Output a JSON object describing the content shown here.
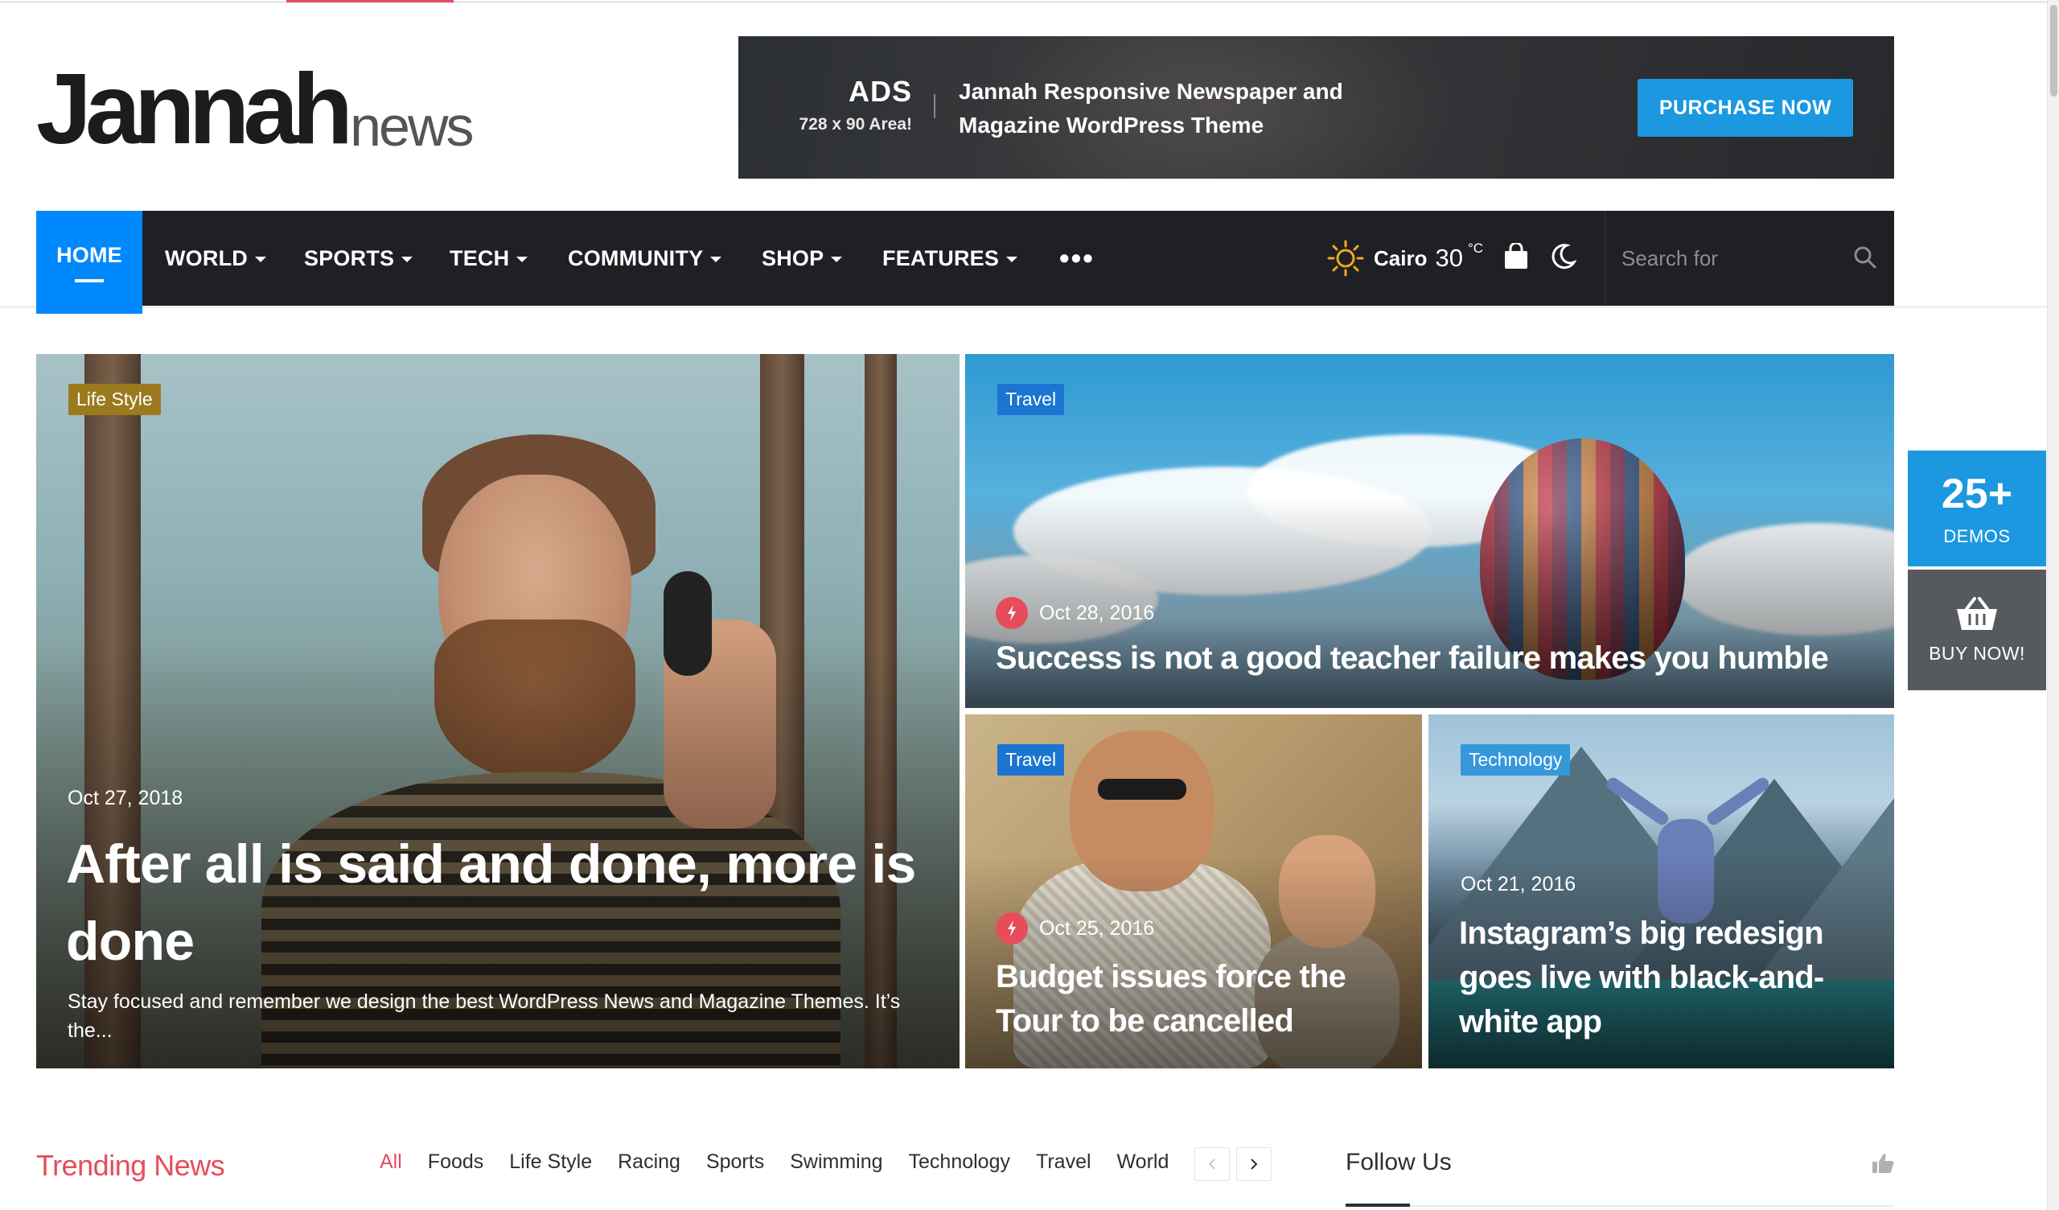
{
  "header": {
    "logo_main": "Jannah",
    "logo_sub": "news",
    "ad": {
      "title": "ADS",
      "size": "728 x 90 Area!",
      "text_line1": "Jannah Responsive Newspaper and",
      "text_line2": "Magazine WordPress Theme",
      "button": "PURCHASE NOW"
    }
  },
  "nav": {
    "items": [
      {
        "label": "HOME"
      },
      {
        "label": "WORLD"
      },
      {
        "label": "SPORTS"
      },
      {
        "label": "TECH"
      },
      {
        "label": "COMMUNITY"
      },
      {
        "label": "SHOP"
      },
      {
        "label": "FEATURES"
      }
    ],
    "more": "•••",
    "weather": {
      "city": "Cairo",
      "temp": "30",
      "unit": "°C"
    },
    "search_placeholder": "Search for"
  },
  "hero": [
    {
      "category": "Life Style",
      "date": "Oct 27, 2018",
      "title": "After all is said and done, more is done",
      "excerpt": "Stay focused and remember we design the best WordPress News and Magazine Themes. It’s the..."
    },
    {
      "category": "Travel",
      "date": "Oct 28, 2016",
      "title": "Success is not a good teacher failure makes you humble"
    },
    {
      "category": "Travel",
      "date": "Oct 25, 2016",
      "title": "Budget issues force the Tour to be cancelled"
    },
    {
      "category": "Technology",
      "date": "Oct 21, 2016",
      "title": "Instagram’s big redesign goes live with black-and-white app"
    }
  ],
  "side": {
    "demos_count": "25+",
    "demos_label": "DEMOS",
    "buy_label": "BUY NOW!"
  },
  "trending": {
    "title": "Trending News",
    "tabs": [
      "All",
      "Foods",
      "Life Style",
      "Racing",
      "Sports",
      "Swimming",
      "Technology",
      "Travel",
      "World"
    ]
  },
  "follow": {
    "title": "Follow Us"
  },
  "colors": {
    "accent_blue": "#0088ff",
    "accent_red": "#e74c5a",
    "nav_bg": "#1f2024",
    "badge_lifestyle": "#9b7a1d",
    "badge_travel": "#1b75d0",
    "badge_technology": "#3498db"
  }
}
